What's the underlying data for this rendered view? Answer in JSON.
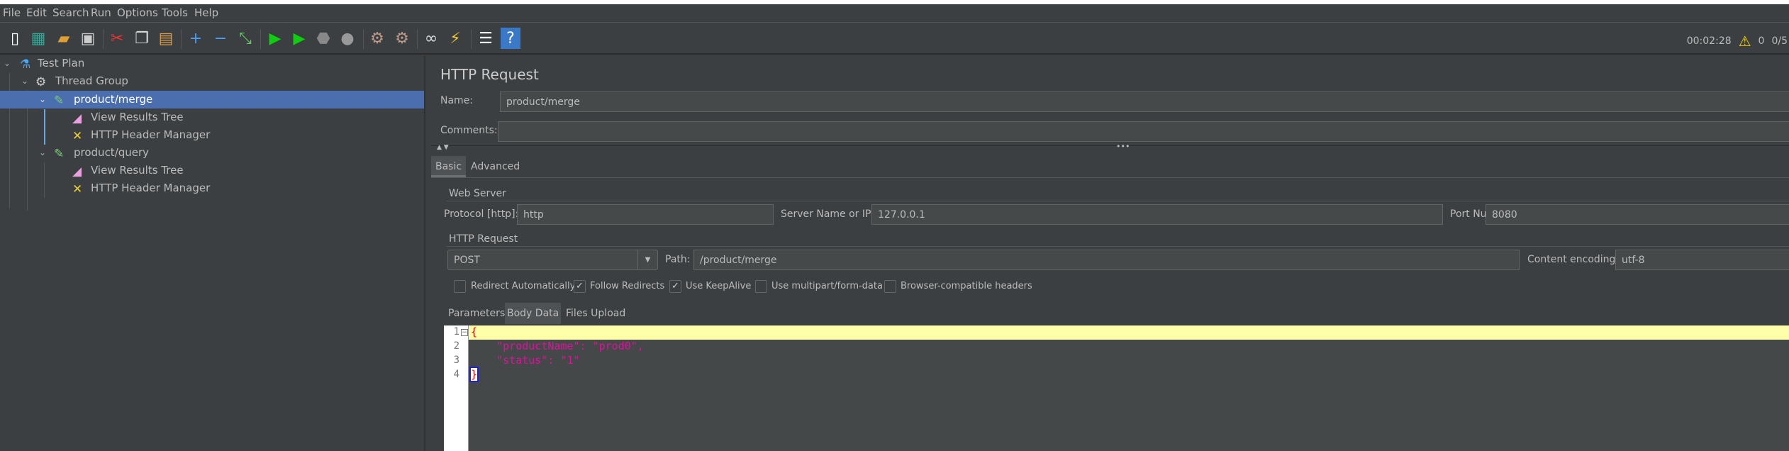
{
  "menu": [
    "File",
    "Edit",
    "Search",
    "Run",
    "Options",
    "Tools",
    "Help"
  ],
  "toolbar_icons": [
    "new-icon",
    "templates-icon",
    "open-icon",
    "save-icon",
    "cut-icon",
    "copy-icon",
    "paste-icon",
    "expand-icon",
    "collapse-icon",
    "toggle-icon",
    "start-icon",
    "start-no-pauses-icon",
    "stop-icon",
    "shutdown-icon",
    "clear-icon",
    "clear-all-icon",
    "search-icon",
    "reset-search-icon",
    "function-helper-icon",
    "help-icon"
  ],
  "status": {
    "elapsed": "00:02:28",
    "errors": "0",
    "threads": "0/5"
  },
  "tree": [
    {
      "label": "Test Plan",
      "icon": "flask-icon"
    },
    {
      "label": "Thread Group",
      "icon": "gear-icon"
    },
    {
      "label": "product/merge",
      "icon": "pipette-icon",
      "selected": true
    },
    {
      "label": "View Results Tree",
      "icon": "chart-icon"
    },
    {
      "label": "HTTP Header Manager",
      "icon": "tools-icon"
    },
    {
      "label": "product/query",
      "icon": "pipette-icon"
    },
    {
      "label": "View Results Tree",
      "icon": "chart-icon"
    },
    {
      "label": "HTTP Header Manager",
      "icon": "tools-icon"
    }
  ],
  "panel": {
    "title": "HTTP Request",
    "name_label": "Name:",
    "name_value": "product/merge",
    "comments_label": "Comments:",
    "comments_value": "",
    "tabs": [
      "Basic",
      "Advanced"
    ],
    "web_server": {
      "legend": "Web Server",
      "protocol_label": "Protocol [http]:",
      "protocol": "http",
      "server_label": "Server Name or IP:",
      "server": "127.0.0.1",
      "port_label": "Port Number:",
      "port": "8080"
    },
    "http_request": {
      "legend": "HTTP Request",
      "method": "POST",
      "path_label": "Path:",
      "path": "/product/merge",
      "encoding_label": "Content encoding:",
      "encoding": "utf-8"
    },
    "checkboxes": [
      {
        "label": "Redirect Automatically",
        "checked": false
      },
      {
        "label": "Follow Redirects",
        "checked": true
      },
      {
        "label": "Use KeepAlive",
        "checked": true
      },
      {
        "label": "Use multipart/form-data",
        "checked": false
      },
      {
        "label": "Browser-compatible headers",
        "checked": false
      }
    ],
    "subtabs": [
      "Parameters",
      "Body Data",
      "Files Upload"
    ],
    "body_lines": [
      "{",
      "    \"productName\": \"prod0\",",
      "    \"status\": \"1\"",
      "}"
    ],
    "line_numbers": [
      "1",
      "2",
      "3",
      "4"
    ]
  }
}
